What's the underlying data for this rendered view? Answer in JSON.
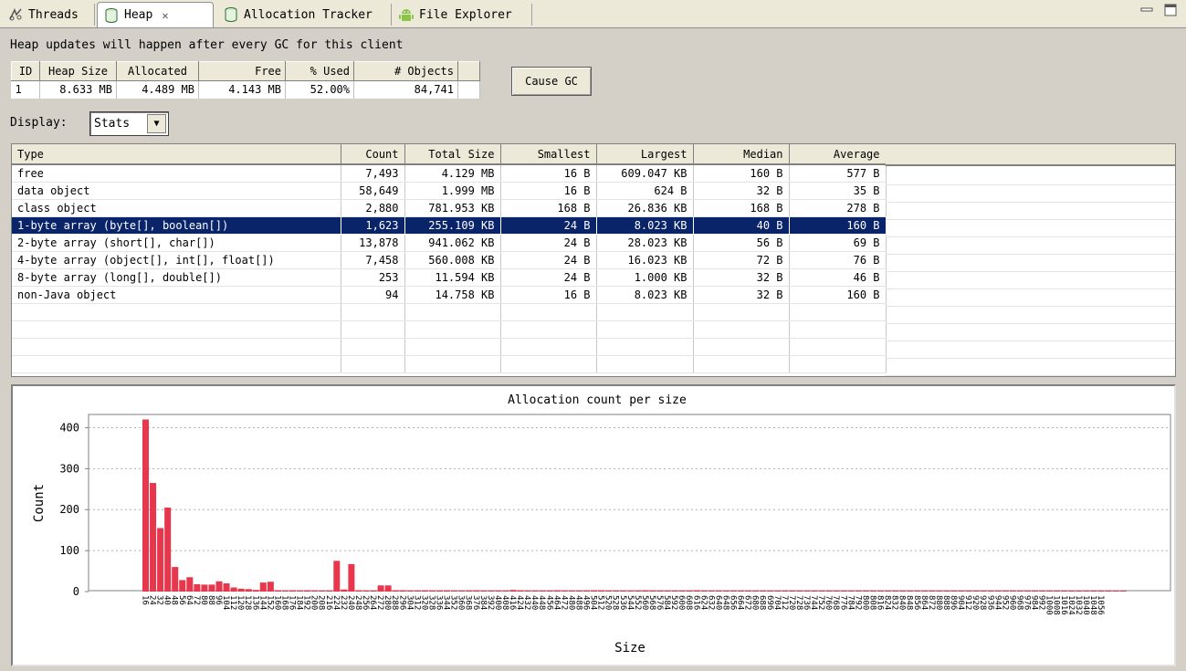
{
  "tabs": [
    {
      "label": "Threads",
      "icon": "threads-icon"
    },
    {
      "label": "Heap",
      "icon": "heap-icon"
    },
    {
      "label": "Allocation Tracker",
      "icon": "allocation-icon"
    },
    {
      "label": "File Explorer",
      "icon": "android-icon"
    }
  ],
  "active_tab": "Heap",
  "gc_message": "Heap updates will happen after every GC for this client",
  "summary": {
    "headers": [
      "ID",
      "Heap Size",
      "Allocated",
      "Free",
      "% Used",
      "# Objects"
    ],
    "row": [
      "1",
      "8.633 MB",
      "4.489 MB",
      "4.143 MB",
      "52.00%",
      "84,741"
    ]
  },
  "cause_gc_label": "Cause GC",
  "display": {
    "label": "Display:",
    "value": "Stats"
  },
  "stats": {
    "headers": [
      "Type",
      "Count",
      "Total Size",
      "Smallest",
      "Largest",
      "Median",
      "Average"
    ],
    "rows": [
      [
        "free",
        "7,493",
        "4.129 MB",
        "16 B",
        "609.047 KB",
        "160 B",
        "577 B"
      ],
      [
        "data object",
        "58,649",
        "1.999 MB",
        "16 B",
        "624 B",
        "32 B",
        "35 B"
      ],
      [
        "class object",
        "2,880",
        "781.953 KB",
        "168 B",
        "26.836 KB",
        "168 B",
        "278 B"
      ],
      [
        "1-byte array (byte[], boolean[])",
        "1,623",
        "255.109 KB",
        "24 B",
        "8.023 KB",
        "40 B",
        "160 B"
      ],
      [
        "2-byte array (short[], char[])",
        "13,878",
        "941.062 KB",
        "24 B",
        "28.023 KB",
        "56 B",
        "69 B"
      ],
      [
        "4-byte array (object[], int[], float[])",
        "7,458",
        "560.008 KB",
        "24 B",
        "16.023 KB",
        "72 B",
        "76 B"
      ],
      [
        "8-byte array (long[], double[])",
        "253",
        "11.594 KB",
        "24 B",
        "1.000 KB",
        "32 B",
        "46 B"
      ],
      [
        "non-Java object",
        "94",
        "14.758 KB",
        "16 B",
        "8.023 KB",
        "32 B",
        "160 B"
      ]
    ],
    "selected_row": 3
  },
  "colors": {
    "bar": "#e8364d",
    "selection": "#0a246a",
    "panel": "#d4d0c8"
  },
  "chart_data": {
    "type": "bar",
    "title": "Allocation count per size",
    "xlabel": "Size",
    "ylabel": "Count",
    "ylim": [
      0,
      430
    ],
    "yticks": [
      0,
      100,
      200,
      300,
      400
    ],
    "grid": true,
    "categories": [
      "16",
      "24",
      "32",
      "40",
      "48",
      "56",
      "64",
      "72",
      "80",
      "88",
      "96",
      "104",
      "112",
      "120",
      "128",
      "136",
      "144",
      "152",
      "160",
      "168",
      "176",
      "184",
      "192",
      "200",
      "208",
      "216",
      "224",
      "232",
      "240",
      "248",
      "256",
      "264",
      "272",
      "280",
      "288",
      "296",
      "304",
      "312",
      "320",
      "328",
      "336",
      "344",
      "352",
      "360",
      "368",
      "376",
      "384",
      "392",
      "400",
      "408",
      "416",
      "424",
      "432",
      "440",
      "448",
      "456",
      "464",
      "472",
      "480",
      "488",
      "496",
      "504",
      "512",
      "520",
      "528",
      "536",
      "544",
      "552",
      "560",
      "568",
      "576",
      "584",
      "592",
      "600",
      "608",
      "616",
      "624",
      "632",
      "640",
      "648",
      "656",
      "664",
      "672",
      "680",
      "688",
      "696",
      "704",
      "712",
      "720",
      "728",
      "736",
      "744",
      "752",
      "760",
      "768",
      "776",
      "784",
      "792",
      "800",
      "808",
      "816",
      "824",
      "832",
      "840",
      "848",
      "856",
      "864",
      "872",
      "880",
      "888",
      "896",
      "904",
      "912",
      "920",
      "928",
      "936",
      "944",
      "952",
      "960",
      "968",
      "976",
      "984",
      "992",
      "1000",
      "1008",
      "1016",
      "1024",
      "1032",
      "1040",
      "1048",
      "1056"
    ],
    "values": [
      420,
      265,
      155,
      205,
      60,
      28,
      35,
      18,
      17,
      17,
      25,
      20,
      10,
      7,
      6,
      4,
      22,
      24,
      3,
      2,
      3,
      2,
      3,
      2,
      2,
      2,
      75,
      5,
      67,
      3,
      2,
      2,
      15,
      15,
      3,
      3,
      2,
      2,
      3,
      2,
      2,
      3,
      2,
      2,
      2,
      3,
      2,
      2,
      2,
      2,
      4,
      3,
      2,
      2,
      2,
      2,
      3,
      2,
      2,
      2,
      2,
      3,
      3,
      2,
      2,
      2,
      2,
      2,
      3,
      2,
      2,
      2,
      2,
      2,
      2,
      3,
      2,
      2,
      2,
      2,
      2,
      2,
      2,
      2,
      2,
      2,
      2,
      2,
      2,
      2,
      2,
      2,
      2,
      2,
      2,
      2,
      2,
      2,
      2,
      2,
      2,
      2,
      2,
      2,
      2,
      2,
      2,
      2,
      2,
      2,
      2,
      2,
      2,
      2,
      2,
      2,
      2,
      2,
      2,
      2,
      2,
      2,
      2,
      2,
      2,
      2,
      2,
      2,
      2,
      2,
      2,
      2,
      2,
      2
    ]
  }
}
